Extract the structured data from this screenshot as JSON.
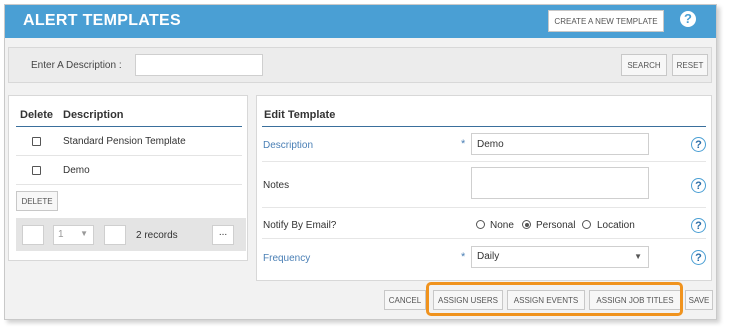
{
  "header": {
    "title": "ALERT TEMPLATES",
    "create_button": "CREATE A NEW TEMPLATE",
    "help_icon": "question-icon"
  },
  "search": {
    "label": "Enter A Description :",
    "value": "",
    "search_button": "SEARCH",
    "reset_button": "RESET"
  },
  "list": {
    "columns": [
      "Delete",
      "Description"
    ],
    "rows": [
      {
        "checked": false,
        "description": "Standard Pension Template"
      },
      {
        "checked": false,
        "description": "Demo"
      }
    ],
    "delete_button": "DELETE",
    "pager": {
      "page": "1",
      "records": "2 records",
      "more_button": "..."
    }
  },
  "edit": {
    "title": "Edit Template",
    "description_label": "Description",
    "description_value": "Demo",
    "notes_label": "Notes",
    "notes_value": "",
    "notify_label": "Notify By Email?",
    "notify_options": [
      "None",
      "Personal",
      "Location"
    ],
    "notify_selected": "Personal",
    "frequency_label": "Frequency",
    "frequency_value": "Daily",
    "required_mark": "*",
    "help_mark": "?"
  },
  "footer": {
    "cancel": "CANCEL",
    "assign_users": "ASSIGN USERS",
    "assign_events": "ASSIGN EVENTS",
    "assign_job_titles": "ASSIGN JOB TITLES",
    "save": "SAVE"
  },
  "colors": {
    "header_bg": "#4a9fd4",
    "label_blue": "#4a7fb5",
    "highlight": "#f0931e"
  }
}
